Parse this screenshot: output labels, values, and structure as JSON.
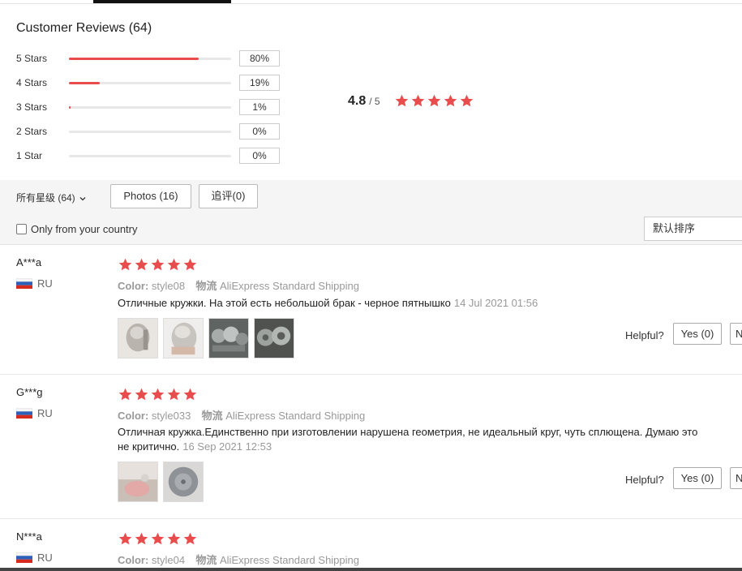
{
  "summary": {
    "title": "Customer Reviews (64)",
    "rows": [
      {
        "label": "5 Stars",
        "percent": 80,
        "percent_label": "80%"
      },
      {
        "label": "4 Stars",
        "percent": 19,
        "percent_label": "19%"
      },
      {
        "label": "3 Stars",
        "percent": 1,
        "percent_label": "1%"
      },
      {
        "label": "2 Stars",
        "percent": 0,
        "percent_label": "0%"
      },
      {
        "label": "1 Star",
        "percent": 0,
        "percent_label": "0%"
      }
    ],
    "average": "4.8",
    "average_max": "/ 5",
    "average_stars": 5
  },
  "filters": {
    "all_stars": "所有星级 (64)",
    "photos": "Photos (16)",
    "additional": "追评(0)",
    "only_country": "Only from your country",
    "sort": "默认排序"
  },
  "reviews": [
    {
      "name": "A***a",
      "country": "RU",
      "stars": 5,
      "color_label": "Color:",
      "color_value": "style08",
      "shipping_label": "物流",
      "shipping_value": "AliExpress Standard Shipping",
      "text": "Отличные кружки. На этой есть небольшой брак - черное пятнышко",
      "date": "14 Jul 2021 01:56",
      "photo_count": 4,
      "helpful": "Helpful?",
      "yes": "Yes (0)",
      "no": "N"
    },
    {
      "name": "G***g",
      "country": "RU",
      "stars": 5,
      "color_label": "Color:",
      "color_value": "style033",
      "shipping_label": "物流",
      "shipping_value": "AliExpress Standard Shipping",
      "text": "Отличная кружка.Единственно при изготовлении нарушена геометрия, не идеальный круг, чуть сплющена. Думаю это не критично.",
      "date": "16 Sep 2021 12:53",
      "photo_count": 2,
      "helpful": "Helpful?",
      "yes": "Yes (0)",
      "no": "N"
    },
    {
      "name": "N***a",
      "country": "RU",
      "stars": 5,
      "color_label": "Color:",
      "color_value": "style04",
      "shipping_label": "物流",
      "shipping_value": "AliExpress Standard Shipping"
    }
  ],
  "colors": {
    "star": "#e84c4c",
    "bar_fill": "#e84c4c",
    "bar_track": "#e8e8e8",
    "muted_text": "#999999"
  },
  "icons": {
    "star": "star-icon",
    "dropdown": "chevron-down-icon",
    "flag": "russia-flag-icon"
  }
}
